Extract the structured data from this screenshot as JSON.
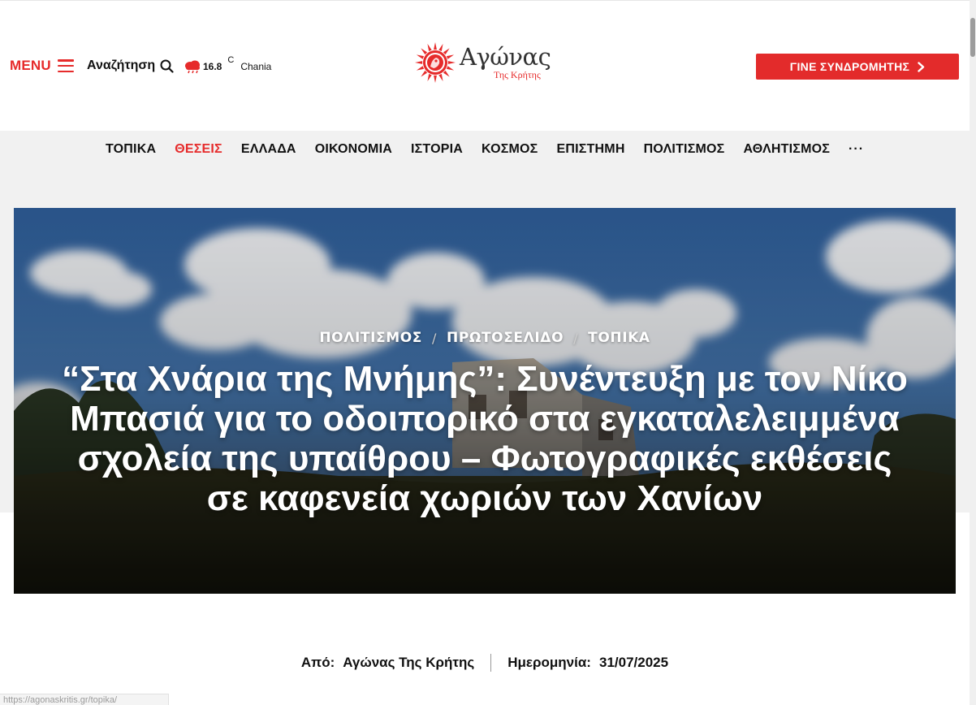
{
  "header": {
    "menu_label": "MENU",
    "search_label": "Αναζήτηση",
    "weather": {
      "temp": "16.8",
      "unit": "C",
      "city": "Chania",
      "icon": "cloud-rain-icon"
    },
    "logo": {
      "main": "Αγώνας",
      "sub": "Της Κρήτης"
    },
    "subscribe_label": "ΓΙΝΕ ΣΥΝΔΡΟΜΗΤΗΣ"
  },
  "nav": {
    "items": [
      "ΤΟΠΙΚΑ",
      "ΘΕΣΕΙΣ",
      "ΕΛΛΑΔΑ",
      "ΟΙΚΟΝΟΜΙΑ",
      "ΙΣΤΟΡΙΑ",
      "ΚΟΣΜΟΣ",
      "ΕΠΙΣΤΗΜΗ",
      "ΠΟΛΙΤΙΣΜΟΣ",
      "ΑΘΛΗΤΙΣΜΟΣ"
    ],
    "active": "ΘΕΣΕΙΣ",
    "more": "···"
  },
  "hero": {
    "categories": [
      "ΠΟΛΙΤΙΣΜΟΣ",
      "ΠΡΩΤΟΣΕΛΙΔΟ",
      "ΤΟΠΙΚΑ"
    ],
    "separator": "/",
    "title": "“Στα Χνάρια της Μνήμης”: Συνέντευξη με τον Νίκο Μπασιά για το οδοιπορικό στα εγκαταλελειμμένα σχολεία της υπαίθρου – Φωτογραφικές εκθέσεις σε καφενεία χωριών των Χανίων"
  },
  "meta": {
    "author_label": "Από:",
    "author": "Αγώνας Της Κρήτης",
    "date_label": "Ημερομηνία:",
    "date": "31/07/2025"
  },
  "status_url": "https://agonaskritis.gr/topika/",
  "colors": {
    "accent": "#e62b2b",
    "nav_bg": "#f1f1f1"
  }
}
